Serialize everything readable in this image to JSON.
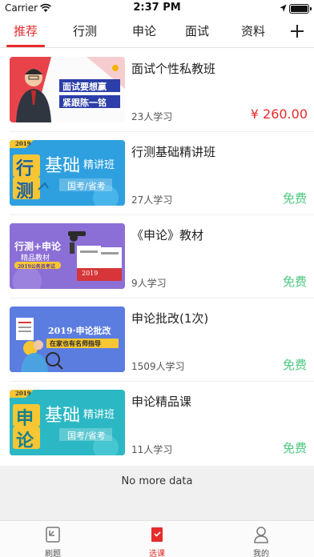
{
  "status_bar": {
    "carrier": "Carrier",
    "time": "2:37 PM"
  },
  "tabs": [
    {
      "label": "推荐",
      "active": true
    },
    {
      "label": "行测",
      "active": false
    },
    {
      "label": "申论",
      "active": false
    },
    {
      "label": "面试",
      "active": false
    },
    {
      "label": "资料",
      "active": false
    }
  ],
  "courses": [
    {
      "title": "面试个性私教班",
      "count": "23人学习",
      "price": "¥ 260.00",
      "free": "",
      "thumb": {
        "line1": "面试要想赢",
        "line2": "紧跟陈一铭"
      }
    },
    {
      "title": "行测基础精讲班",
      "count": "27人学习",
      "price": "",
      "free": "免费",
      "thumb": {
        "year": "2019",
        "big1": "行",
        "big2": "测",
        "head": "基础",
        "tail": "精讲班",
        "sub": "国考/省考"
      }
    },
    {
      "title": "《申论》教材",
      "count": "9人学习",
      "price": "",
      "free": "免费",
      "thumb": {
        "line1": "行测+申论",
        "line2": "精品教材",
        "line3": "2019公务员考试",
        "book": "2019"
      }
    },
    {
      "title": "申论批改(1次)",
      "count": "1509人学习",
      "price": "",
      "free": "免费",
      "thumb": {
        "line1": "2019·申论批改",
        "line2": "在家也有名师指导"
      }
    },
    {
      "title": "申论精品课",
      "count": "11人学习",
      "price": "",
      "free": "免费",
      "thumb": {
        "year": "2019",
        "big1": "申",
        "big2": "论",
        "head": "基础",
        "tail": "精讲班",
        "sub": "国考/省考"
      }
    }
  ],
  "footer": {
    "no_more": "No more data"
  },
  "bottom_nav": [
    {
      "label": "刷题",
      "icon": "practice-icon",
      "active": false
    },
    {
      "label": "选课",
      "icon": "course-select-icon",
      "active": true
    },
    {
      "label": "我的",
      "icon": "profile-icon",
      "active": false
    }
  ],
  "colors": {
    "accent": "#e62b2b",
    "free": "#4cc77f",
    "thumb_blue": "#2ea0df",
    "thumb_purple": "#8c6fd6",
    "thumb_teal": "#2bb8c4"
  }
}
